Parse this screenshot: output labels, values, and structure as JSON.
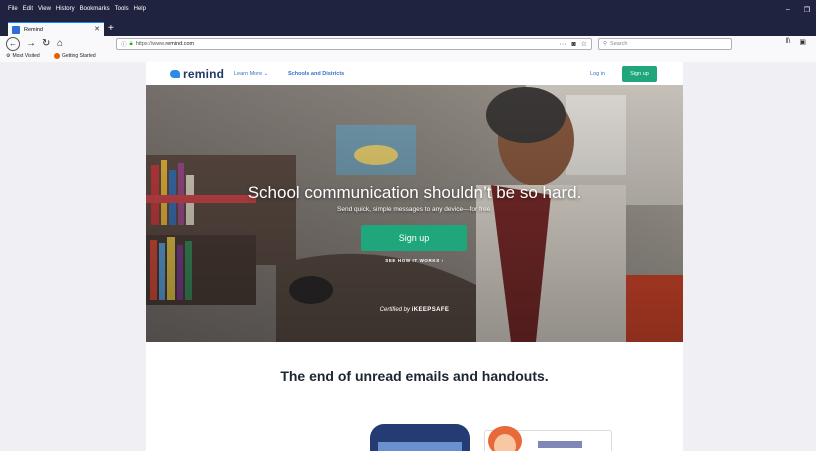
{
  "browser": {
    "menus": [
      "File",
      "Edit",
      "View",
      "History",
      "Bookmarks",
      "Tools",
      "Help"
    ],
    "tab_title": "Remind",
    "url_prefix": "https://www.",
    "url_host": "remind.com",
    "search_placeholder": "Search",
    "bookmarks": [
      {
        "label": "Most Visited",
        "icon": "gear-icon"
      },
      {
        "label": "Getting Started",
        "icon": "firefox-icon"
      }
    ]
  },
  "site": {
    "logo_text": "remind",
    "nav": {
      "learn_more": "Learn More ⌄",
      "schools": "Schools and Districts",
      "login": "Log in",
      "signup": "Sign up"
    },
    "hero": {
      "title": "School communication shouldn’t be so hard.",
      "subtitle": "Send quick, simple messages to any device—for free.",
      "button": "Sign up",
      "how_link": "SEE HOW IT WORKS ›",
      "certified_prefix": "Certified by",
      "certified_brand": "iKEEPSAFE"
    },
    "tagline": "The end of unread emails and handouts."
  },
  "colors": {
    "chrome_dark": "#202340",
    "brand_green": "#1fa67a",
    "brand_blue": "#2d8ae6"
  }
}
